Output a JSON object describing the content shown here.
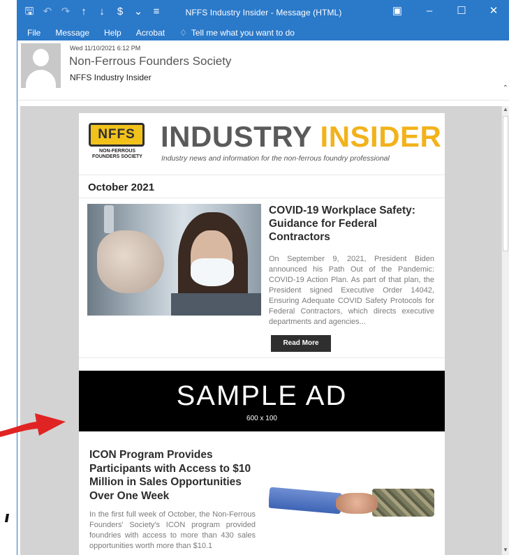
{
  "window": {
    "title": "NFFS Industry Insider  -  Message (HTML)",
    "qat_icons": [
      "save-icon",
      "undo-icon",
      "redo-icon",
      "up-arrow-icon",
      "down-arrow-icon",
      "dollar-tag-icon",
      "dropdown-icon",
      "customize-icon"
    ],
    "controls": [
      "restore-ribbon-icon",
      "minimize-icon",
      "maximize-icon",
      "close-icon"
    ],
    "accent": "#2b79c9"
  },
  "menu": {
    "items": [
      "File",
      "Message",
      "Help",
      "Acrobat"
    ],
    "tell_me": "Tell me what you want to do"
  },
  "header": {
    "date": "Wed 11/10/2021 6:12 PM",
    "sender": "Non-Ferrous Founders Society",
    "subject": "NFFS Industry Insider"
  },
  "newsletter": {
    "logo_text": "NFFS",
    "logo_name_line1": "NON-FERROUS",
    "logo_name_line2": "FOUNDERS SOCIETY",
    "banner_word1": "INDUSTRY",
    "banner_word2": "INSIDER",
    "tagline": "Industry news and information for the non-ferrous foundry professional",
    "issue": "October 2021",
    "article1": {
      "title": "COVID-19 Workplace Safety: Guidance for Federal Contractors",
      "body": "On September 9, 2021, President Biden announced his Path Out of the Pandemic: COVID-19 Action Plan. As part of that plan, the President signed Executive Order 14042, Ensuring Adequate COVID Safety Protocols for Federal Contractors, which directs executive departments and agencies...",
      "button": "Read More"
    },
    "ad": {
      "headline": "SAMPLE AD",
      "size": "600 x 100"
    },
    "article2": {
      "title": "ICON Program Provides Participants with Access to $10 Million in Sales Opportunities Over One Week",
      "body": "In the first full week of October, the Non-Ferrous Founders' Society's ICON program provided foundries with access to more than 430 sales opportunities worth more than $10.1"
    },
    "brand_yellow": "#f2b21b"
  }
}
